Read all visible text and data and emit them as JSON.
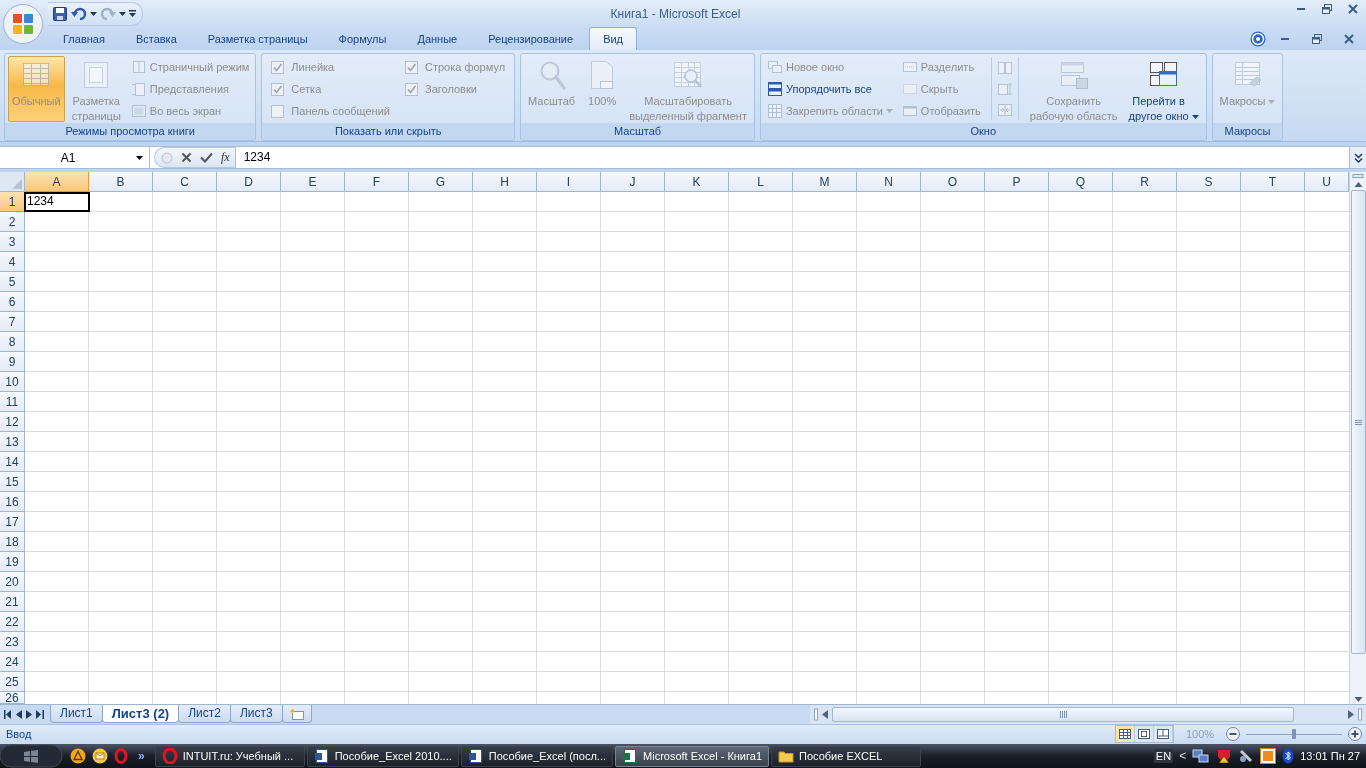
{
  "window": {
    "title": "Книга1 - Microsoft Excel"
  },
  "tabs": [
    {
      "label": "Главная",
      "selected": false
    },
    {
      "label": "Вставка",
      "selected": false
    },
    {
      "label": "Разметка страницы",
      "selected": false
    },
    {
      "label": "Формулы",
      "selected": false
    },
    {
      "label": "Данные",
      "selected": false
    },
    {
      "label": "Рецензирование",
      "selected": false
    },
    {
      "label": "Вид",
      "selected": true
    }
  ],
  "ribbon_groups": [
    {
      "title": "Режимы просмотра книги",
      "items": [
        {
          "kind": "large",
          "label": "Обычный",
          "selected": true,
          "disabled": true
        },
        {
          "kind": "large",
          "label": "Разметка\nстраницы",
          "selected": false,
          "disabled": true
        },
        {
          "kind": "stack",
          "items": [
            {
              "label": "Страничный режим",
              "disabled": true
            },
            {
              "label": "Представления",
              "disabled": true
            },
            {
              "label": "Во весь экран",
              "disabled": true
            }
          ]
        }
      ]
    },
    {
      "title": "Показать или скрыть",
      "items": [
        {
          "kind": "checks",
          "items": [
            {
              "label": "Линейка",
              "checked": true,
              "disabled": true
            },
            {
              "label": "Сетка",
              "checked": true,
              "disabled": true
            },
            {
              "label": "Панель сообщений",
              "checked": false,
              "disabled": true
            }
          ]
        },
        {
          "kind": "checks",
          "items": [
            {
              "label": "Строка формул",
              "checked": true,
              "disabled": true
            },
            {
              "label": "Заголовки",
              "checked": true,
              "disabled": true
            }
          ]
        }
      ]
    },
    {
      "title": "Масштаб",
      "items": [
        {
          "kind": "large",
          "label": "Масштаб",
          "selected": false,
          "disabled": true
        },
        {
          "kind": "large",
          "label": "100%",
          "selected": false,
          "disabled": true
        },
        {
          "kind": "large",
          "label": "Масштабировать\nвыделенный фрагмент",
          "selected": false,
          "disabled": true
        }
      ]
    },
    {
      "title": "Окно",
      "items": [
        {
          "kind": "stack",
          "items": [
            {
              "label": "Новое окно",
              "disabled": true
            },
            {
              "label": "Упорядочить все",
              "disabled": false
            },
            {
              "label": "Закрепить области",
              "disabled": true,
              "dropdown": true
            }
          ]
        },
        {
          "kind": "stack",
          "items": [
            {
              "label": "Разделить",
              "disabled": true
            },
            {
              "label": "Скрыть",
              "disabled": true
            },
            {
              "label": "Отобразить",
              "disabled": true
            }
          ]
        },
        {
          "kind": "icon_stack",
          "items": [
            {
              "disabled": true
            },
            {
              "disabled": true
            },
            {
              "disabled": true
            }
          ]
        },
        {
          "kind": "large",
          "label": "Сохранить\nрабочую область",
          "selected": false,
          "disabled": true
        },
        {
          "kind": "large",
          "label": "Перейти в\nдругое окно",
          "selected": false,
          "disabled": false,
          "dropdown": true
        }
      ]
    },
    {
      "title": "Макросы",
      "items": [
        {
          "kind": "large",
          "label": "Макросы",
          "selected": false,
          "disabled": true,
          "dropdown": true
        }
      ]
    }
  ],
  "formula_bar": {
    "name_box": "A1",
    "function_label": "fx",
    "value": "1234"
  },
  "grid": {
    "columns": [
      {
        "label": "A",
        "selected": true
      },
      {
        "label": "B",
        "selected": false
      },
      {
        "label": "C",
        "selected": false
      },
      {
        "label": "D",
        "selected": false
      },
      {
        "label": "E",
        "selected": false
      },
      {
        "label": "F",
        "selected": false
      },
      {
        "label": "G",
        "selected": false
      },
      {
        "label": "H",
        "selected": false
      },
      {
        "label": "I",
        "selected": false
      },
      {
        "label": "J",
        "selected": false
      },
      {
        "label": "K",
        "selected": false
      },
      {
        "label": "L",
        "selected": false
      },
      {
        "label": "M",
        "selected": false
      },
      {
        "label": "N",
        "selected": false
      },
      {
        "label": "O",
        "selected": false
      },
      {
        "label": "P",
        "selected": false
      },
      {
        "label": "Q",
        "selected": false
      },
      {
        "label": "R",
        "selected": false
      },
      {
        "label": "S",
        "selected": false
      },
      {
        "label": "T",
        "selected": false
      },
      {
        "label": "U",
        "selected": false
      }
    ],
    "rows": [
      {
        "label": "1",
        "selected": true,
        "cells": [
          "1234"
        ]
      },
      {
        "label": "2",
        "selected": false
      },
      {
        "label": "3",
        "selected": false
      },
      {
        "label": "4",
        "selected": false
      },
      {
        "label": "5",
        "selected": false
      },
      {
        "label": "6",
        "selected": false
      },
      {
        "label": "7",
        "selected": false
      },
      {
        "label": "8",
        "selected": false
      },
      {
        "label": "9",
        "selected": false
      },
      {
        "label": "10",
        "selected": false
      },
      {
        "label": "11",
        "selected": false
      },
      {
        "label": "12",
        "selected": false
      },
      {
        "label": "13",
        "selected": false
      },
      {
        "label": "14",
        "selected": false
      },
      {
        "label": "15",
        "selected": false
      },
      {
        "label": "16",
        "selected": false
      },
      {
        "label": "17",
        "selected": false
      },
      {
        "label": "18",
        "selected": false
      },
      {
        "label": "19",
        "selected": false
      },
      {
        "label": "20",
        "selected": false
      },
      {
        "label": "21",
        "selected": false
      },
      {
        "label": "22",
        "selected": false
      },
      {
        "label": "23",
        "selected": false
      },
      {
        "label": "24",
        "selected": false
      },
      {
        "label": "25",
        "selected": false
      },
      {
        "label": "26",
        "selected": false
      }
    ]
  },
  "sheet_tabs": [
    {
      "label": "Лист1",
      "selected": false
    },
    {
      "label": "Лист3 (2)",
      "selected": true
    },
    {
      "label": "Лист2",
      "selected": false
    },
    {
      "label": "Лист3",
      "selected": false
    }
  ],
  "status_bar": {
    "mode": "Ввод",
    "view_buttons": [
      {
        "selected": true
      },
      {
        "selected": false
      },
      {
        "selected": false
      }
    ],
    "zoom": "100%",
    "zoom_slider": {
      "level": 0.5
    }
  },
  "taskbar": {
    "quick_launch_more": "»",
    "tasks": [
      {
        "kind": "browser",
        "label": "INTUIT.ru: Учебный ...",
        "selected": false
      },
      {
        "kind": "document",
        "label": "Пособие_Excel 2010....",
        "selected": false
      },
      {
        "kind": "document",
        "label": "Пособие_Excel (посл...",
        "selected": false
      },
      {
        "kind": "spreadsheet",
        "label": "Microsoft Excel - Книга1",
        "selected": true
      },
      {
        "kind": "folder",
        "label": "Пособие EXCEL",
        "selected": false
      }
    ],
    "tray": {
      "language": "EN",
      "expand": "<",
      "clock": "13:01 Пн 27"
    }
  }
}
